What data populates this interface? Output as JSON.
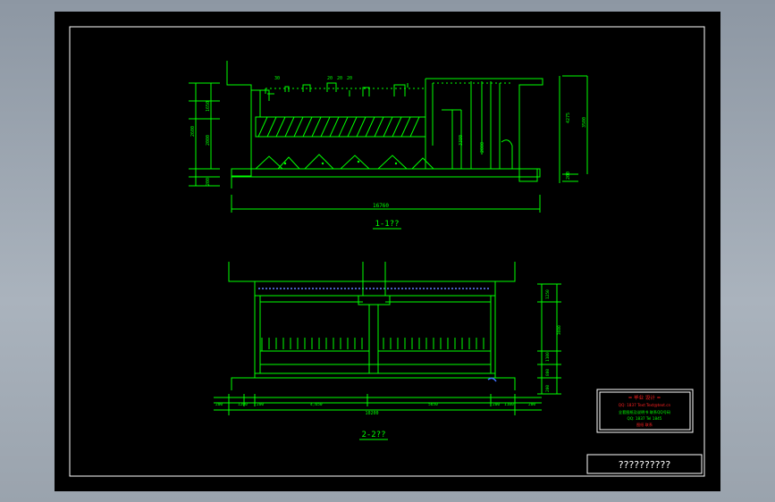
{
  "drawing": {
    "section1": {
      "title": "1-1??",
      "total_length": "16760",
      "top_dims": [
        "30",
        "20",
        "20",
        "20",
        "20"
      ],
      "left_dims": [
        "2600",
        "2000",
        "1650",
        "200",
        "800",
        "200",
        "1000",
        "200",
        "300"
      ],
      "mid_dims": [
        "3380",
        "2000"
      ],
      "right_dims": [
        "4275",
        "3500",
        "200",
        "300"
      ]
    },
    "section2": {
      "title": "2-2??",
      "total_length": "10200",
      "bottom_dims": [
        "200",
        "1200",
        "200",
        "4,650",
        "5650",
        "200",
        "1100",
        "200"
      ],
      "right_dims": [
        "1250",
        "1100",
        "800",
        "3600",
        "200"
      ]
    },
    "stamp": {
      "line1": "= 毕业 设计 =",
      "line2": "QQ: 1837 Text:Text@text.cn",
      "line3": "全套图纸及说明书 联系QQ号码",
      "line4": "QQ: 1837 Tel 1845",
      "line5": "图纸 联系"
    },
    "title_block": {
      "label": "??????????"
    },
    "colors": {
      "line": "#00ff00",
      "frame": "#ffffff",
      "stamp_text": "#ff2020",
      "background": "#000000"
    }
  }
}
